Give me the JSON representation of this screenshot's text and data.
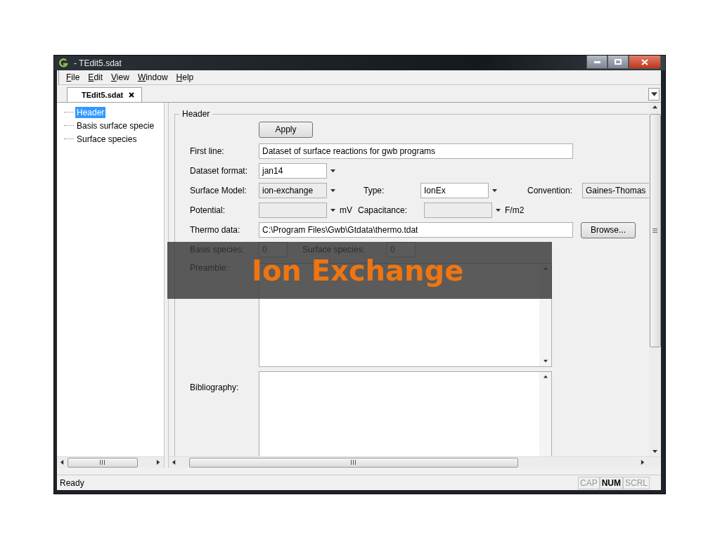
{
  "window": {
    "title": "- TEdit5.sdat"
  },
  "menu": [
    {
      "label": "File"
    },
    {
      "label": "Edit"
    },
    {
      "label": "View"
    },
    {
      "label": "Window"
    },
    {
      "label": "Help"
    }
  ],
  "tabs": [
    {
      "label": "TEdit5.sdat",
      "selected": true
    }
  ],
  "tree": [
    {
      "label": "Header",
      "selected": true
    },
    {
      "label": "Basis surface specie",
      "selected": false
    },
    {
      "label": "Surface species",
      "selected": false
    }
  ],
  "form": {
    "group": "Header",
    "apply": "Apply",
    "first_line": {
      "label": "First line:",
      "value": "Dataset of surface reactions for gwb programs"
    },
    "dataset_format": {
      "label": "Dataset format:",
      "value": "jan14",
      "disabled": false
    },
    "surface_model": {
      "label": "Surface Model:",
      "value": "ion-exchange",
      "disabled": true
    },
    "type": {
      "label": "Type:",
      "value": "IonEx",
      "disabled": false
    },
    "convention": {
      "label": "Convention:",
      "value": "Gaines-Thomas",
      "disabled": true
    },
    "potential": {
      "label": "Potential:",
      "disabled": true,
      "unit": "mV"
    },
    "capacitance": {
      "label": "Capacitance:",
      "disabled": true,
      "unit": "F/m2"
    },
    "thermo_data": {
      "label": "Thermo data:",
      "value": "C:\\Program Files\\Gwb\\Gtdata\\thermo.tdat",
      "button": "Browse..."
    },
    "basis_species": {
      "label": "Basis species:",
      "value": "0"
    },
    "surface_species": {
      "label": "Surface species:",
      "value": "0"
    },
    "preamble": {
      "label": "Preamble:"
    },
    "bibliography": {
      "label": "Bibliography:"
    }
  },
  "status_bar": {
    "text": "Ready",
    "indicators": [
      {
        "label": "CAP",
        "on": false
      },
      {
        "label": "NUM",
        "on": true
      },
      {
        "label": "SCRL",
        "on": false
      }
    ]
  },
  "overlay": {
    "title": "Ion Exchange"
  }
}
